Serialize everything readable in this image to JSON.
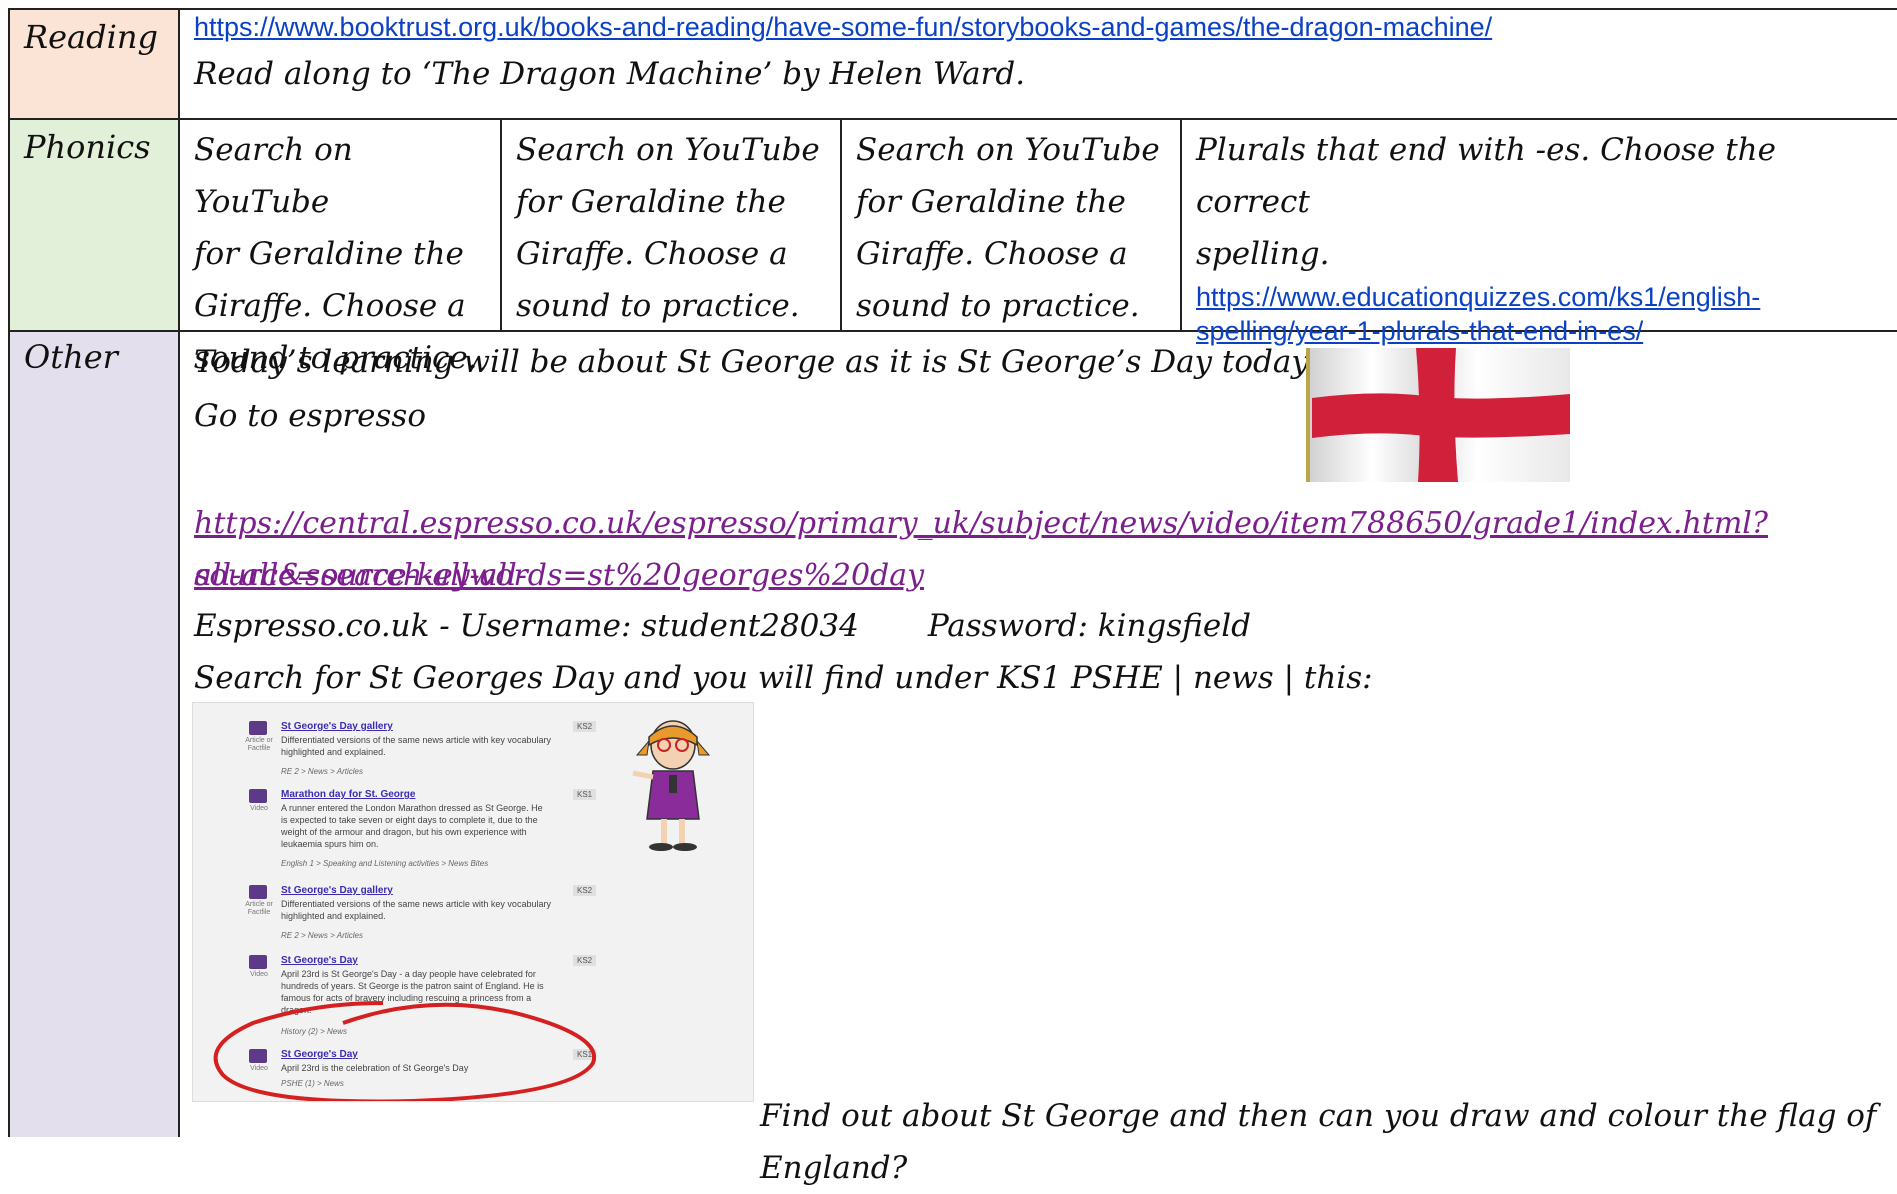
{
  "rows": {
    "reading": {
      "label": "Reading",
      "link": "https://www.booktrust.org.uk/books-and-reading/have-some-fun/storybooks-and-games/the-dragon-machine/",
      "text": "Read along to ‘The Dragon Machine’ by Helen Ward."
    },
    "phonics": {
      "label": "Phonics",
      "cells": [
        [
          "Search on YouTube",
          "for Geraldine the",
          "Giraffe.  Choose a",
          "sound to practice."
        ],
        [
          "Search on YouTube",
          "for Geraldine the",
          "Giraffe.  Choose a",
          "sound to practice."
        ],
        [
          "Search on YouTube",
          "for Geraldine the",
          "Giraffe.  Choose a",
          "sound to practice."
        ]
      ],
      "plurals_line1": "Plurals that end with -es.  Choose the correct",
      "plurals_line2": "spelling.",
      "plurals_link_line1": "https://www.educationquizzes.com/ks1/english-",
      "plurals_link_line2": "spelling/year-1-plurals-that-end-in-es/"
    },
    "other": {
      "label": "Other",
      "line1": "Today’s learning will be about St George as it is St George’s Day today!",
      "line2": "Go to espresso",
      "link_line1": "https://central.espresso.co.uk/espresso/primary_uk/subject/news/video/item788650/grade1/index.html?source=search-all-all-",
      "link_line2": "all-all&source-keywords=st%20georges%20day",
      "login": "Espresso.co.uk - Username: student28034       Password: kingsfield",
      "search": "Search for St Georges Day and you will find under KS1 PSHE | news | this:",
      "final": "Find out about St George and then can you draw and colour the flag of England?"
    }
  },
  "espresso_results": [
    {
      "type": "Article or Factfile",
      "title": "St George's Day gallery",
      "desc": "Differentiated versions of the same news article with key vocabulary highlighted and explained.",
      "crumb": "RE 2 > News > Articles",
      "ks": "KS2"
    },
    {
      "type": "Video",
      "title": "Marathon day for St. George",
      "desc": "A runner entered the London Marathon dressed as St George. He is expected to take seven or eight days to complete it, due to the weight of the armour and dragon, but his own experience with leukaemia spurs him on.",
      "crumb": "English 1 > Speaking and Listening activities > News Bites",
      "ks": "KS1"
    },
    {
      "type": "Article or Factfile",
      "title": "St George's Day gallery",
      "desc": "Differentiated versions of the same news article with key vocabulary highlighted and explained.",
      "crumb": "RE 2 > News > Articles",
      "ks": "KS2"
    },
    {
      "type": "Video",
      "title": "St George's Day",
      "desc": "April 23rd is St George's Day - a day people have celebrated for hundreds of years. St George is the patron saint of England. He is famous for acts of bravery including rescuing a princess from a dragon.",
      "crumb": "History (2) > News",
      "ks": "KS2"
    },
    {
      "type": "Video",
      "title": "St George's Day",
      "desc": "April 23rd is the celebration of St George's Day",
      "crumb": "PSHE (1) > News",
      "ks": "KS1"
    }
  ],
  "colors": {
    "reading_bg": "#fbe4d5",
    "phonics_bg": "#e2efd9",
    "other_bg": "#e4dfec",
    "flag_red": "#d0203a",
    "circle_red": "#d42020"
  }
}
